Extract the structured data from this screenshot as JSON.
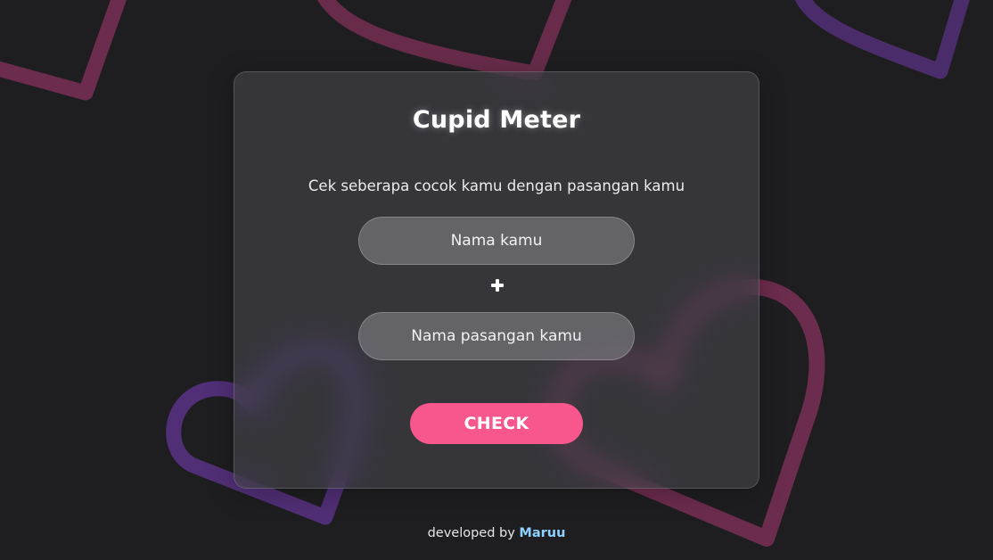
{
  "card": {
    "title": "Cupid Meter",
    "subtitle": "Cek seberapa cocok kamu dengan pasangan kamu",
    "name_input": {
      "placeholder": "Nama kamu",
      "value": ""
    },
    "partner_input": {
      "placeholder": "Nama pasangan kamu",
      "value": ""
    },
    "plus_icon": "plus-icon",
    "check_label": "CHECK"
  },
  "footer": {
    "prefix": "developed by",
    "author": "Maruu"
  },
  "colors": {
    "background": "#1e1e21",
    "accent_pink": "#f7578c",
    "heart_pink": "#8a3360",
    "heart_purple": "#5b327e",
    "author_link": "#8fd0ff"
  }
}
